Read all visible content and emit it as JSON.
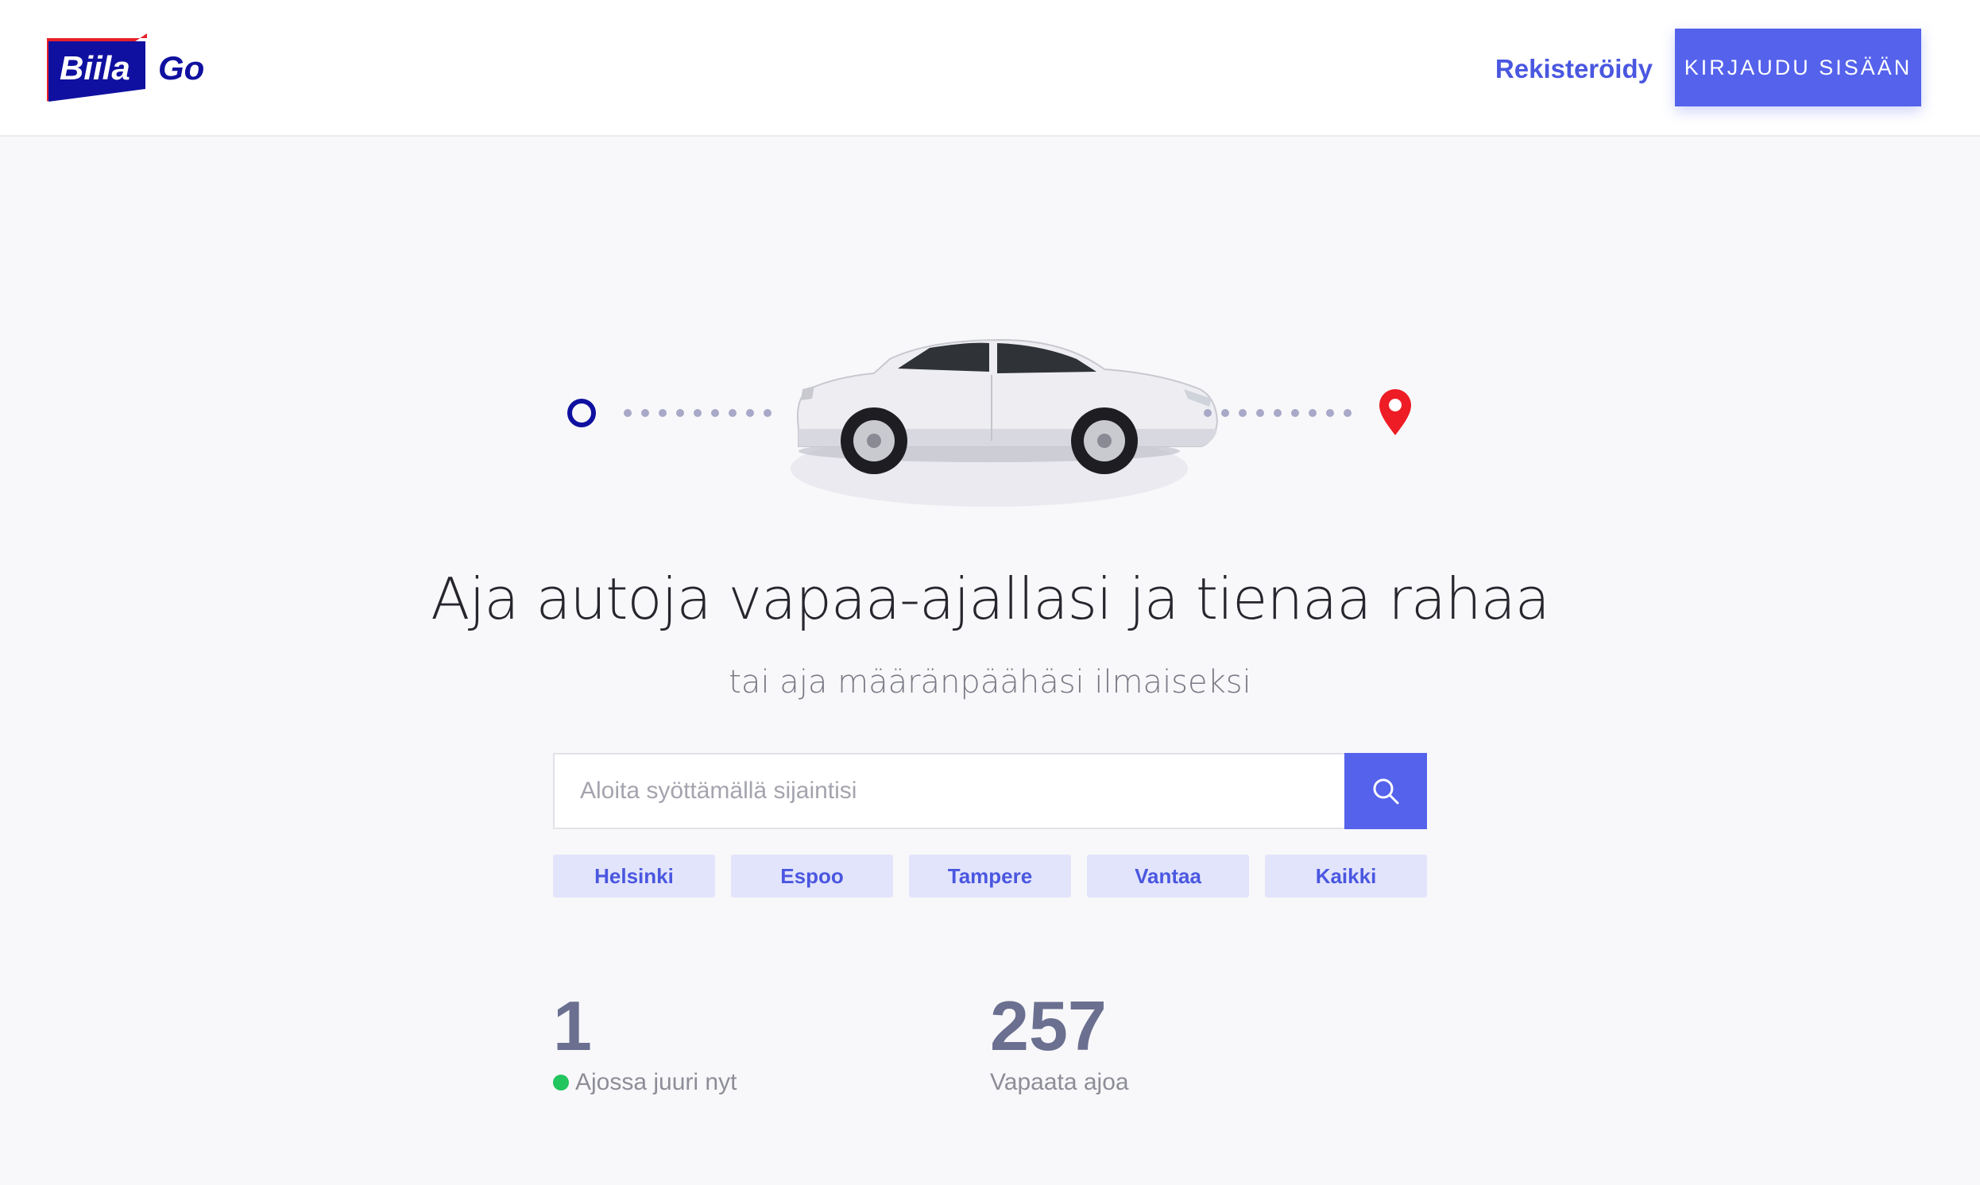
{
  "brand": {
    "logo_box_text": "Biila",
    "logo_suffix_text": "Go",
    "primary_color": "#5462ec",
    "logo_blue": "#1010a0",
    "logo_red": "#e8202a"
  },
  "header": {
    "register_label": "Rekisteröidy",
    "login_label": "KIRJAUDU SISÄÄN"
  },
  "hero": {
    "title": "Aja autoja vapaa-ajallasi ja tienaa rahaa",
    "subtitle": "tai aja määränpäähäsi ilmaiseksi",
    "illustration_icons": [
      "origin-circle-icon",
      "car-icon",
      "location-pin-icon"
    ]
  },
  "search": {
    "placeholder": "Aloita syöttämällä sijaintisi",
    "value": "",
    "button_icon": "search-icon"
  },
  "cities": [
    "Helsinki",
    "Espoo",
    "Tampere",
    "Vantaa",
    "Kaikki"
  ],
  "stats": {
    "driving_now_value": "1",
    "driving_now_label": "Ajossa juuri nyt",
    "free_rides_value": "257",
    "free_rides_label": "Vapaata ajoa",
    "live_color": "#22c55e"
  }
}
